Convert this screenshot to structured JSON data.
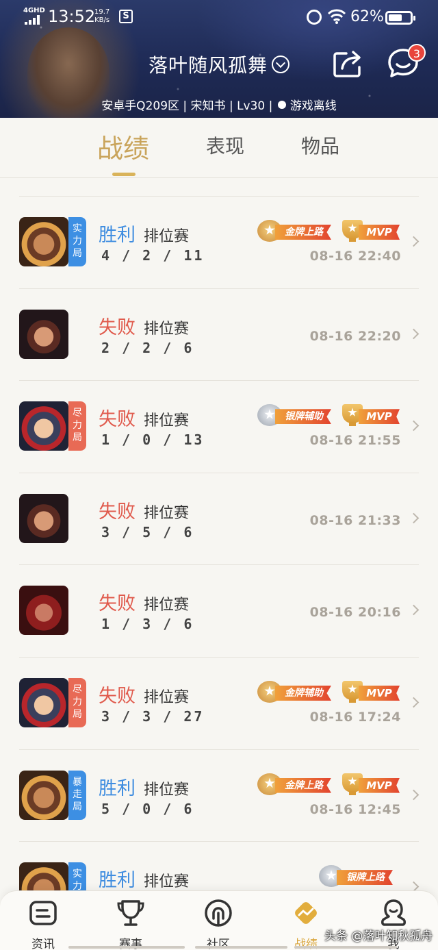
{
  "status_bar": {
    "network": "4GHD",
    "time": "13:52",
    "speed_value": "19.7",
    "speed_unit": "KB/s",
    "battery": "62%",
    "battery_level": 0.62
  },
  "header": {
    "player_name": "落叶随风孤舞",
    "info": "安卓手Q209区 | 宋知书 | Lv30 |",
    "status": "游戏离线",
    "chat_badge": "3"
  },
  "tabs": [
    {
      "label": "战绩",
      "active": true
    },
    {
      "label": "表现",
      "active": false
    },
    {
      "label": "物品",
      "active": false
    }
  ],
  "matches": [
    {
      "result": "胜利",
      "outcome": "win",
      "mode": "排位赛",
      "kda": "4/2/11",
      "time": "08-16 22:40",
      "tag": "实力局",
      "tag_color": "blue",
      "hero": "a",
      "badge": {
        "type": "gold",
        "label": "金牌上路"
      },
      "mvp": "MVP"
    },
    {
      "result": "失败",
      "outcome": "loss",
      "mode": "排位赛",
      "kda": "2/2/6",
      "time": "08-16 22:20",
      "tag": "",
      "tag_color": "",
      "hero": "b",
      "badge": null,
      "mvp": null
    },
    {
      "result": "失败",
      "outcome": "loss",
      "mode": "排位赛",
      "kda": "1/0/13",
      "time": "08-16 21:55",
      "tag": "尽力局",
      "tag_color": "red",
      "hero": "c",
      "badge": {
        "type": "silver",
        "label": "银牌辅助"
      },
      "mvp": "MVP"
    },
    {
      "result": "失败",
      "outcome": "loss",
      "mode": "排位赛",
      "kda": "3/5/6",
      "time": "08-16 21:33",
      "tag": "",
      "tag_color": "",
      "hero": "b",
      "badge": null,
      "mvp": null
    },
    {
      "result": "失败",
      "outcome": "loss",
      "mode": "排位赛",
      "kda": "1/3/6",
      "time": "08-16 20:16",
      "tag": "",
      "tag_color": "",
      "hero": "d",
      "badge": null,
      "mvp": null
    },
    {
      "result": "失败",
      "outcome": "loss",
      "mode": "排位赛",
      "kda": "3/3/27",
      "time": "08-16 17:24",
      "tag": "尽力局",
      "tag_color": "red",
      "hero": "c",
      "badge": {
        "type": "gold",
        "label": "金牌辅助"
      },
      "mvp": "MVP"
    },
    {
      "result": "胜利",
      "outcome": "win",
      "mode": "排位赛",
      "kda": "5/0/6",
      "time": "08-16 12:45",
      "tag": "暴走局",
      "tag_color": "blue",
      "hero": "a",
      "badge": {
        "type": "gold",
        "label": "金牌上路"
      },
      "mvp": "MVP"
    },
    {
      "result": "胜利",
      "outcome": "win",
      "mode": "排位赛",
      "kda": "",
      "time": "",
      "tag": "实力",
      "tag_color": "blue",
      "hero": "a",
      "badge": {
        "type": "silver",
        "label": "银牌上路"
      },
      "mvp": null
    }
  ],
  "bottom_nav": [
    {
      "label": "资讯",
      "icon": "news-icon",
      "active": false
    },
    {
      "label": "赛事",
      "icon": "trophy-icon",
      "active": false
    },
    {
      "label": "社区",
      "icon": "community-icon",
      "active": false
    },
    {
      "label": "战绩",
      "icon": "record-icon",
      "active": true
    },
    {
      "label": "我",
      "icon": "profile-icon",
      "active": false
    }
  ],
  "watermark": "头条 @落叶知秋孤舟",
  "colors": {
    "accent_gold": "#c9a45b",
    "win_blue": "#3f8de0",
    "loss_red": "#e05a4c"
  }
}
